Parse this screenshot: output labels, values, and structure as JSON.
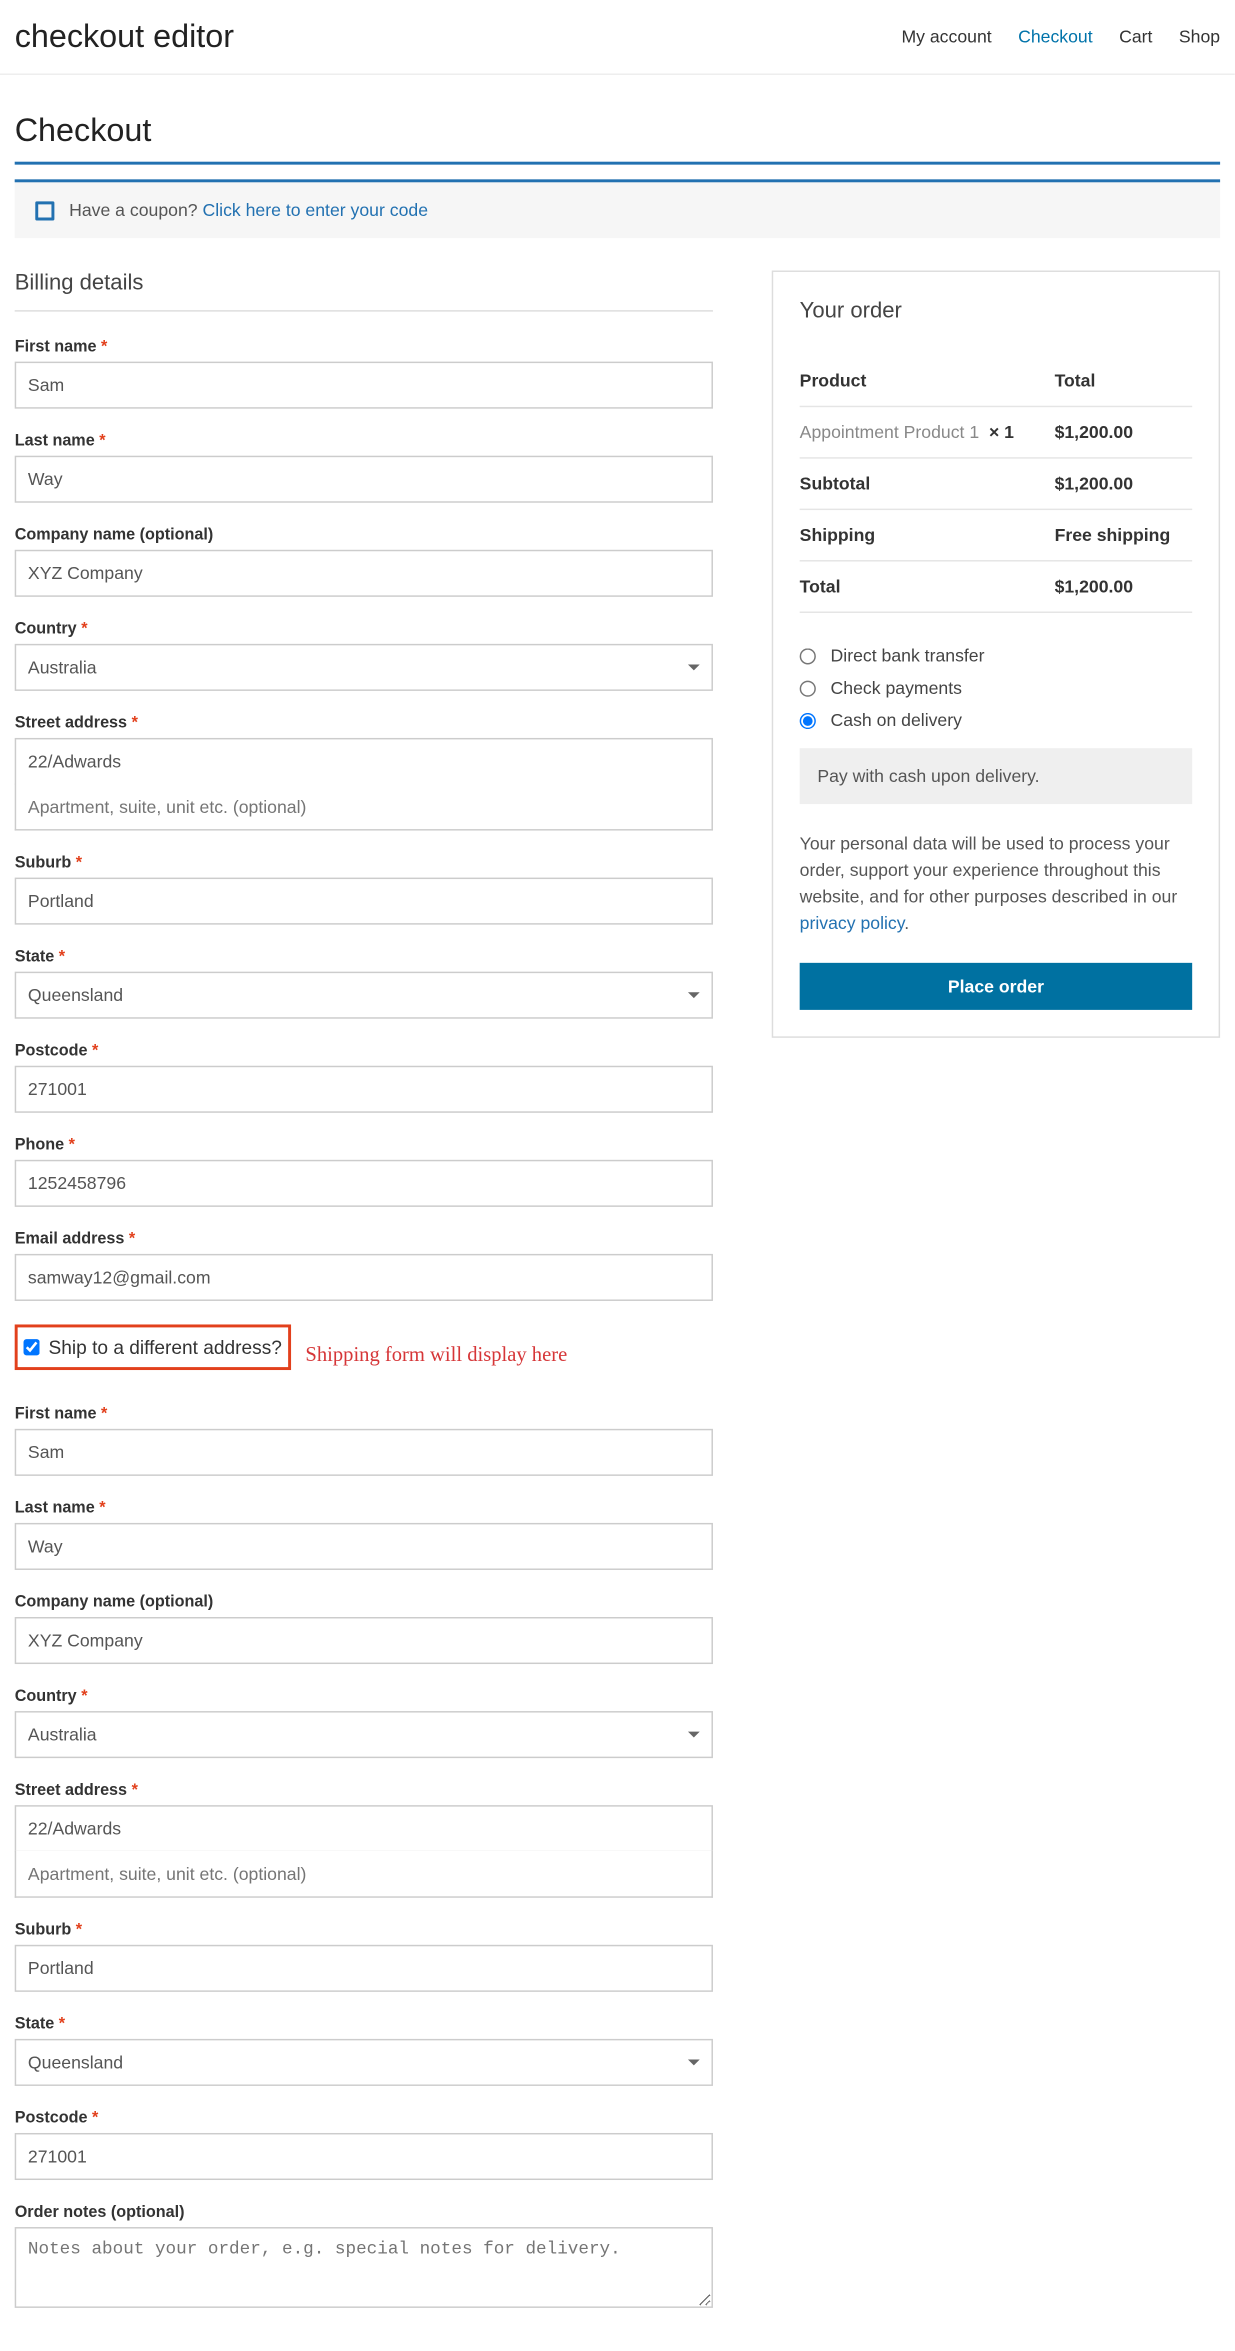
{
  "header": {
    "site_title": "checkout editor",
    "nav": [
      {
        "label": "My account",
        "active": false
      },
      {
        "label": "Checkout",
        "active": true
      },
      {
        "label": "Cart",
        "active": false
      },
      {
        "label": "Shop",
        "active": false
      }
    ]
  },
  "page": {
    "title": "Checkout",
    "coupon_have": "Have a coupon?",
    "coupon_link": "Click here to enter your code"
  },
  "billing": {
    "heading": "Billing details",
    "first_name": {
      "label": "First name",
      "value": "Sam",
      "required": true
    },
    "last_name": {
      "label": "Last name",
      "value": "Way",
      "required": true
    },
    "company": {
      "label": "Company name (optional)",
      "value": "XYZ Company",
      "required": false
    },
    "country": {
      "label": "Country",
      "value": "Australia",
      "required": true
    },
    "street": {
      "label": "Street address",
      "value": "22/Adwards",
      "placeholder2": "Apartment, suite, unit etc. (optional)",
      "required": true
    },
    "suburb": {
      "label": "Suburb",
      "value": "Portland",
      "required": true
    },
    "state": {
      "label": "State",
      "value": "Queensland",
      "required": true
    },
    "postcode": {
      "label": "Postcode",
      "value": "271001",
      "required": true
    },
    "phone": {
      "label": "Phone",
      "value": "1252458796",
      "required": true
    },
    "email": {
      "label": "Email address",
      "value": "samway12@gmail.com",
      "required": true
    }
  },
  "shipping_toggle": {
    "label": "Ship to a different address?",
    "annotation": "Shipping form will display here"
  },
  "shipping": {
    "first_name": {
      "label": "First name",
      "value": "Sam",
      "required": true
    },
    "last_name": {
      "label": "Last name",
      "value": "Way",
      "required": true
    },
    "company": {
      "label": "Company name (optional)",
      "value": "XYZ Company",
      "required": false
    },
    "country": {
      "label": "Country",
      "value": "Australia",
      "required": true
    },
    "street": {
      "label": "Street address",
      "value": "22/Adwards",
      "placeholder2": "Apartment, suite, unit etc. (optional)",
      "required": true
    },
    "suburb": {
      "label": "Suburb",
      "value": "Portland",
      "required": true
    },
    "state": {
      "label": "State",
      "value": "Queensland",
      "required": true
    },
    "postcode": {
      "label": "Postcode",
      "value": "271001",
      "required": true
    },
    "notes": {
      "label": "Order notes (optional)",
      "placeholder": "Notes about your order, e.g. special notes for delivery."
    }
  },
  "order": {
    "heading": "Your order",
    "col_product": "Product",
    "col_total": "Total",
    "item_name": "Appointment Product 1",
    "item_qty": "× 1",
    "item_total": "$1,200.00",
    "subtotal_label": "Subtotal",
    "subtotal_value": "$1,200.00",
    "shipping_label": "Shipping",
    "shipping_value": "Free shipping",
    "total_label": "Total",
    "total_value": "$1,200.00"
  },
  "payment": {
    "opt1": "Direct bank transfer",
    "opt2": "Check payments",
    "opt3": "Cash on delivery",
    "desc": "Pay with cash upon delivery.",
    "privacy_text": "Your personal data will be used to process your order, support your experience throughout this website, and for other purposes described in our ",
    "privacy_link": "privacy policy",
    "button": "Place order"
  }
}
